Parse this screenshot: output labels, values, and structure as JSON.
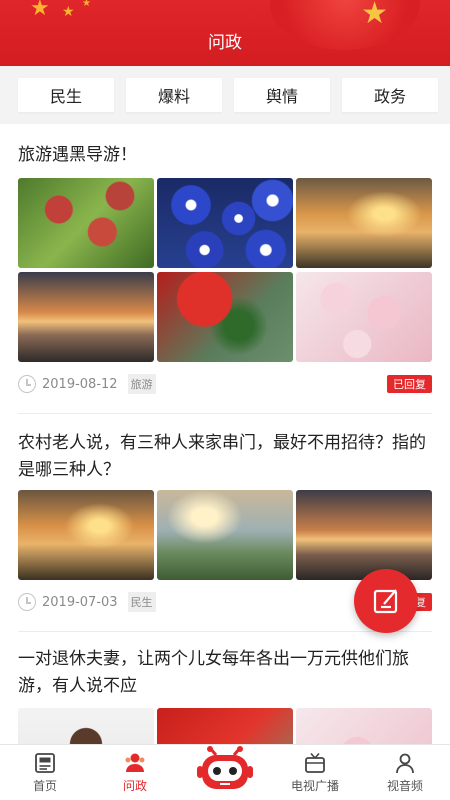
{
  "header": {
    "title": "问政"
  },
  "tabs": [
    {
      "label": "民生"
    },
    {
      "label": "爆料"
    },
    {
      "label": "舆情"
    },
    {
      "label": "政务"
    }
  ],
  "posts": [
    {
      "title": "旅游遇黑导游！",
      "date": "2019-08-12",
      "tag": "旅游",
      "status": "已回复",
      "images": [
        "apples",
        "blue-flowers",
        "sunset-family",
        "sunset-silhouette",
        "red-rose",
        "cherry-blossom"
      ]
    },
    {
      "title": "农村老人说，有三种人来家串门，最好不用招待？指的是哪三种人？",
      "date": "2019-07-03",
      "tag": "民生",
      "status": "已回复",
      "images": [
        "sunset-family",
        "lake-girl",
        "sunset-silhouette"
      ]
    },
    {
      "title": "一对退休夫妻，让两个儿女每年各出一万元供他们旅游，有人说不应",
      "images": [
        "child",
        "red-rose",
        "cherry-blossom"
      ]
    }
  ],
  "fab": {
    "icon": "compose-icon"
  },
  "bottom_nav": [
    {
      "label": "首页",
      "icon": "newspaper-icon"
    },
    {
      "label": "问政",
      "icon": "user-group-icon",
      "active": true
    },
    {
      "label": "",
      "icon": "robot-icon"
    },
    {
      "label": "电视广播",
      "icon": "tv-icon"
    },
    {
      "label": "视音频",
      "icon": "person-icon"
    }
  ],
  "colors": {
    "brand_red": "#e4292d",
    "header_red": "#d31d21",
    "tab_bg": "#f3f3f3"
  }
}
